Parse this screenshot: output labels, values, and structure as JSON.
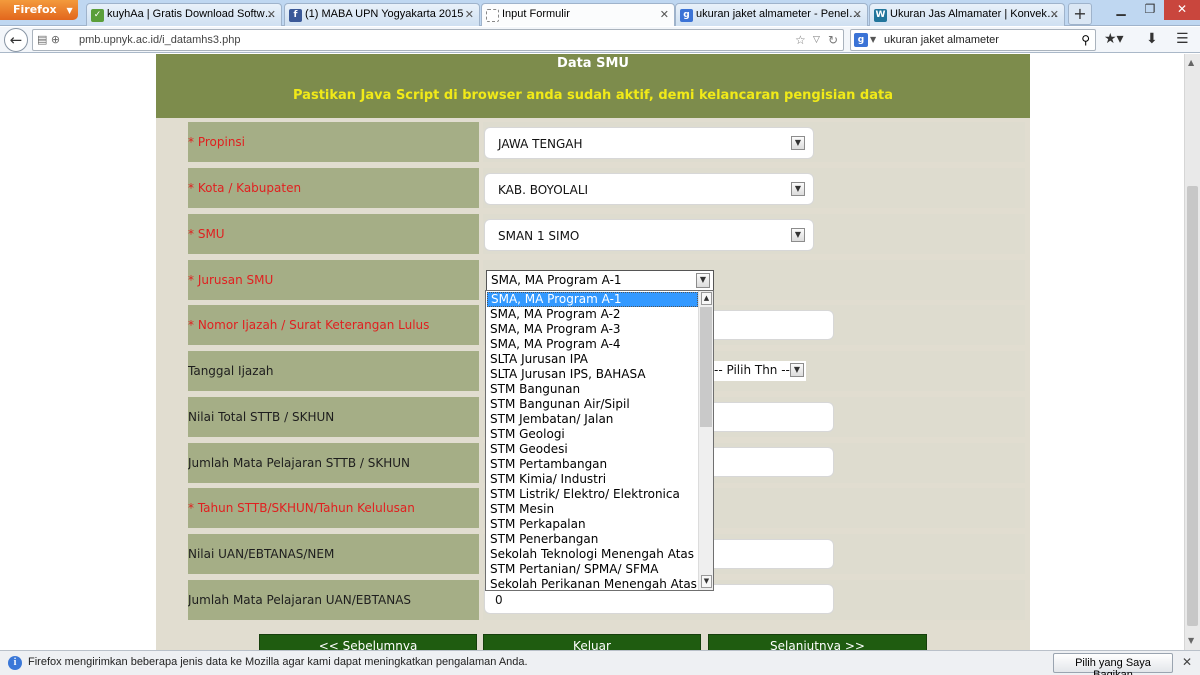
{
  "browser": {
    "menu_label": "Firefox",
    "tabs": [
      {
        "title": "kuyhAa | Gratis Download Softw…",
        "icon": "kuyhaa-icon",
        "icon_color": "#5a9e3a"
      },
      {
        "title": "(1) MABA UPN Yogyakarta 2015",
        "icon": "facebook-icon",
        "icon_color": "#3b5998"
      },
      {
        "title": "Input Formulir",
        "icon": "blank-page-icon",
        "icon_color": "#ffffff"
      },
      {
        "title": "ukuran jaket almameter - Penel…",
        "icon": "google-icon",
        "icon_color": "#3b73d6"
      },
      {
        "title": "Ukuran Jas Almamater | Konvek…",
        "icon": "wordpress-icon",
        "icon_color": "#21759b"
      }
    ],
    "active_tab_index": 2,
    "url": "pmb.upnyk.ac.id/i_datamhs3.php",
    "search_text": "ukuran jaket almameter"
  },
  "page": {
    "heading": "Data SMU",
    "notice": "Pastikan Java Script di browser anda sudah aktif, demi kelancaran pengisian data",
    "colors": {
      "header_band": "#7d8c4c",
      "notice_text": "#f1ea18",
      "label_cell": "#a5ae86",
      "required_label": "#e02020",
      "button": "#1f5c10"
    },
    "rows": [
      {
        "label": "Propinsi",
        "required": true,
        "value": "JAWA TENGAH"
      },
      {
        "label": "Kota / Kabupaten",
        "required": true,
        "value": "KAB. BOYOLALI"
      },
      {
        "label": "SMU",
        "required": true,
        "value": "SMAN 1 SIMO"
      },
      {
        "label": "Jurusan SMU",
        "required": true,
        "value": "SMA, MA Program A-1"
      },
      {
        "label": "Nomor Ijazah / Surat Keterangan Lulus",
        "required": true,
        "value": ""
      },
      {
        "label": "Tanggal Ijazah",
        "required": false,
        "value": "-- Pilih Thn ---"
      },
      {
        "label": "Nilai Total STTB / SKHUN",
        "required": false,
        "value": ""
      },
      {
        "label": "Jumlah Mata Pelajaran STTB / SKHUN",
        "required": false,
        "value": ""
      },
      {
        "label": "Tahun STTB/SKHUN/Tahun Kelulusan",
        "required": true,
        "value": ""
      },
      {
        "label": "Nilai UAN/EBTANAS/NEM",
        "required": false,
        "value": ""
      },
      {
        "label": "Jumlah Mata Pelajaran UAN/EBTANAS",
        "required": false,
        "value": "0"
      }
    ],
    "required_marker": "*",
    "jurusan_options": [
      "SMA, MA Program A-1",
      "SMA, MA Program A-2",
      "SMA, MA Program A-3",
      "SMA, MA Program A-4",
      "SLTA Jurusan IPA",
      "SLTA Jurusan IPS, BAHASA",
      "STM Bangunan",
      "STM Bangunan Air/Sipil",
      "STM Jembatan/ Jalan",
      "STM Geologi",
      "STM Geodesi",
      "STM Pertambangan",
      "STM Kimia/ Industri",
      "STM Listrik/ Elektro/ Elektronica",
      "STM Mesin",
      "STM Perkapalan",
      "STM Penerbangan",
      "Sekolah Teknologi Menengah Atas",
      "STM Pertanian/ SPMA/ SFMA",
      "Sekolah Perikanan Menengah Atas"
    ],
    "selected_option_index": 0,
    "buttons": {
      "prev": "<< Sebelumnya",
      "exit": "Keluar",
      "next": "Selanjutnya >>"
    }
  },
  "notification": {
    "text": "Firefox mengirimkan beberapa jenis data ke Mozilla agar kami dapat meningkatkan pengalaman Anda.",
    "button": "Pilih yang Saya Bagikan"
  }
}
